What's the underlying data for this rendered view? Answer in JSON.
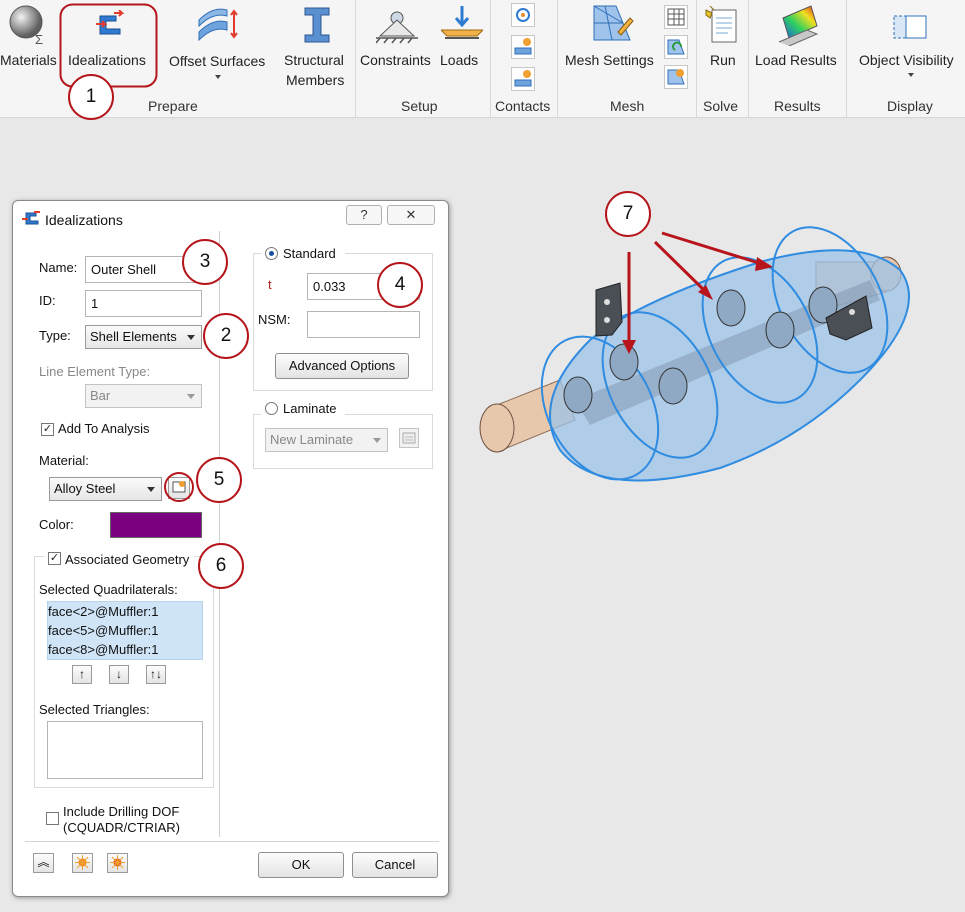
{
  "ribbon": {
    "buttons": {
      "materials": "Materials",
      "idealizations": "Idealizations",
      "offset_surfaces": "Offset Surfaces",
      "structural_line1": "Structural",
      "structural_line2": "Members",
      "constraints": "Constraints",
      "loads": "Loads",
      "mesh_settings": "Mesh Settings",
      "run": "Run",
      "load_results": "Load Results",
      "object_visibility": "Object Visibility"
    },
    "groups": {
      "prepare": "Prepare",
      "setup": "Setup",
      "contacts": "Contacts",
      "mesh": "Mesh",
      "solve": "Solve",
      "results": "Results",
      "display": "Display"
    }
  },
  "callouts": [
    "1",
    "2",
    "3",
    "4",
    "5",
    "6",
    "7"
  ],
  "dialog": {
    "title": "Idealizations",
    "help": "?",
    "name_label": "Name:",
    "name_value": "Outer Shell",
    "id_label": "ID:",
    "id_value": "1",
    "type_label": "Type:",
    "type_value": "Shell Elements",
    "line_type_label": "Line Element Type:",
    "line_type_value": "Bar",
    "add_to_analysis": "Add To Analysis",
    "add_to_analysis_checked": true,
    "material_label": "Material:",
    "material_value": "Alloy Steel",
    "color_label": "Color:",
    "color_value": "#7a0080",
    "associated_geometry": "Associated Geometry",
    "associated_geometry_checked": true,
    "selected_quads_label": "Selected Quadrilaterals:",
    "selected_quads": [
      "face<2>@Muffler:1",
      "face<5>@Muffler:1",
      "face<8>@Muffler:1"
    ],
    "selected_triangles_label": "Selected Triangles:",
    "drilling_line1": "Include Drilling DOF",
    "drilling_line2": "(CQUADR/CTRIAR)",
    "drilling_checked": false,
    "standard_label": "Standard",
    "standard_selected": true,
    "t_label": "t",
    "t_value": "0.033",
    "nsm_label": "NSM:",
    "nsm_value": "",
    "advanced_options": "Advanced Options",
    "laminate_label": "Laminate",
    "laminate_value": "New Laminate",
    "ok": "OK",
    "cancel": "Cancel"
  },
  "colors": {
    "callout_border": "#b5161c",
    "shell_fill": "#9cc3e8",
    "shell_edge": "#2f8ce0",
    "pipe": "#e6c7ad",
    "arrow": "#b8141b"
  }
}
